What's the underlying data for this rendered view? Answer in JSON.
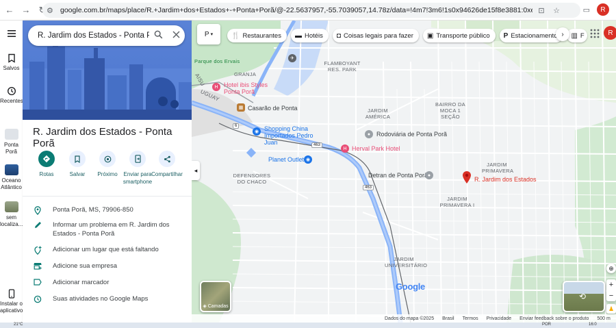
{
  "browser": {
    "url": "google.com.br/maps/place/R.+Jardim+dos+Estados+-+Ponta+Porã/@-22.5637957,-55.7039057,14.78z/data=!4m7!3m6!1s0x94626de15f8e3881:0xe49e01663342685b!8m2!3d-22.56543…",
    "profile_initial": "R"
  },
  "rail": {
    "saved": "Salvos",
    "recents": "Recentes",
    "item_ponta_pora": "Ponta Porã",
    "item_ocean": "Oceano Atlântico",
    "item_sem_local": "sem localiza...",
    "install_app": "Instalar o aplicativo"
  },
  "panel": {
    "search_query": "R. Jardim dos Estados - Ponta Porã",
    "title": "R. Jardim dos Estados - Ponta Porã",
    "actions": {
      "rotas": "Rotas",
      "salvar": "Salvar",
      "proximo": "Próximo",
      "enviar": "Enviar para smartphone",
      "compartilhar": "Compartilhar"
    },
    "info": {
      "address": "Ponta Porã, MS, 79906-850",
      "report": "Informar um problema em R. Jardim dos Estados - Ponta Porã",
      "add_place": "Adicionar um lugar que está faltando",
      "add_business": "Adicione sua empresa",
      "add_label": "Adicionar marcador",
      "activities": "Suas atividades no Google Maps"
    }
  },
  "map": {
    "chips": [
      "Restaurantes",
      "Hotéis",
      "Coisas legais para fazer",
      "Transporte público",
      "Estacionamento",
      "F"
    ],
    "labels": {
      "parque": "Parque dos Ervais",
      "granja": "GRANJA",
      "flamboyant": "FLAMBOYANT RES. PARK",
      "bairro_moca": "BAIRRO DA MOCA 1 SEÇÃO",
      "jardim_america": "JARDIM AMÉRICA",
      "defensores": "DEFENSORES DO CHACO",
      "jardim_primavera": "JARDIM PRIMAVERA",
      "jardim_primavera_i": "JARDIM PRIMAVERA I",
      "jardim_universitario": "JARDIM UNIVERSITÁRIO",
      "uguay": "UGUAY",
      "aisu": "AISU"
    },
    "pois": {
      "hotel_ibis": "Hotel ibis Styles Ponta Porã",
      "casarao": "Casarão de Ponta",
      "shopping": "Shopping China Importados Pedro Juan",
      "rodoviaria": "Rodoviária de Ponta Porã",
      "herval": "Herval Park Hotel",
      "planet": "Planet Outlet",
      "detran": "Detran de Ponta Porã",
      "selected": "R. Jardim dos Estados"
    },
    "roads": {
      "r463a": "463",
      "r463b": "463",
      "r6": "6"
    },
    "layers_label": "Camadas",
    "google": "Google",
    "footer": [
      "Dados do mapa ©2025",
      "Brasil",
      "Termos",
      "Privacidade",
      "Enviar feedback sobre o produto",
      "500 m"
    ]
  },
  "taskbar": {
    "temp": "21°C",
    "lang": "POR",
    "time": "16:0"
  },
  "colors": {
    "accent_teal": "#0b7c74",
    "pin_red": "#d93025",
    "road_blue": "#8ab4f8",
    "hero_blue": "#4b76cf"
  }
}
